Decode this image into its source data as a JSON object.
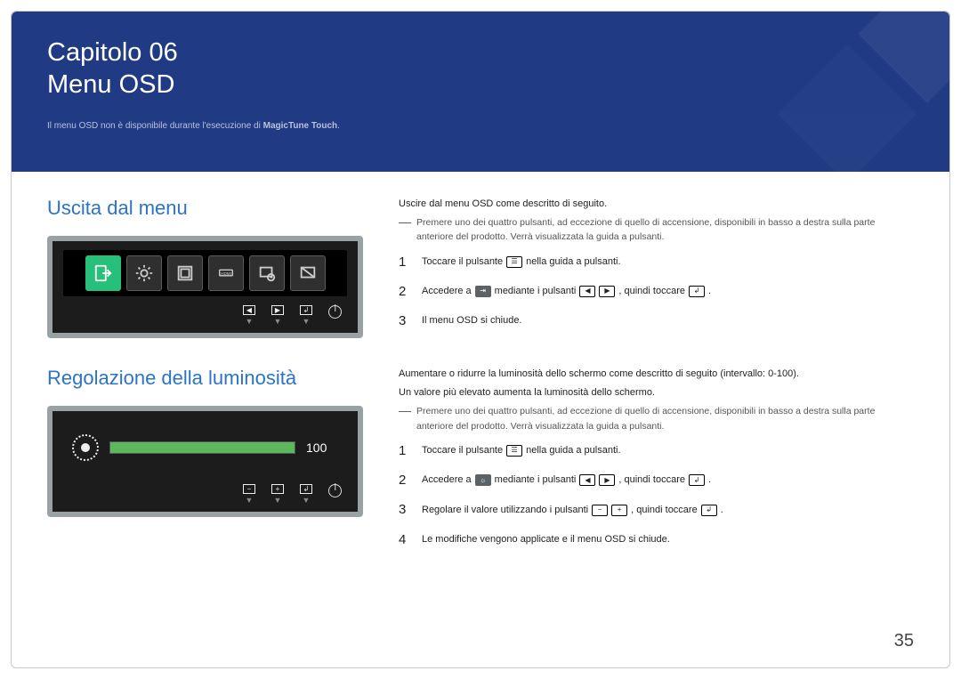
{
  "header": {
    "chapter_label": "Capitolo 06",
    "title": "Menu OSD",
    "note_prefix": "Il menu OSD non è disponibile durante l'esecuzione di ",
    "note_bold": "MagicTune Touch",
    "note_suffix": "."
  },
  "section_exit": {
    "title": "Uscita dal menu",
    "intro": "Uscire dal menu OSD come descritto di seguito.",
    "dash_note": "Premere uno dei quattro pulsanti, ad eccezione di quello di accensione, disponibili in basso a destra sulla parte anteriore del prodotto. Verrà visualizzata la guida a pulsanti.",
    "steps": {
      "s1_a": "Toccare il pulsante",
      "s1_b": "nella guida a pulsanti.",
      "s2_a": "Accedere a",
      "s2_b": "mediante i pulsanti",
      "s2_c": ", quindi toccare",
      "s2_d": ".",
      "s3": "Il menu OSD si chiude."
    }
  },
  "section_bright": {
    "title": "Regolazione della luminosità",
    "intro1": "Aumentare o ridurre la luminosità dello schermo come descritto di seguito (intervallo: 0-100).",
    "intro2": "Un valore più elevato aumenta la luminosità dello schermo.",
    "dash_note": "Premere uno dei quattro pulsanti, ad eccezione di quello di accensione, disponibili in basso a destra sulla parte anteriore del prodotto. Verrà visualizzata la guida a pulsanti.",
    "steps": {
      "s1_a": "Toccare il pulsante",
      "s1_b": "nella guida a pulsanti.",
      "s2_a": "Accedere a",
      "s2_b": "mediante i pulsanti",
      "s2_c": ", quindi toccare",
      "s2_d": ".",
      "s3_a": "Regolare il valore utilizzando i pulsanti",
      "s3_b": ", quindi toccare",
      "s3_c": ".",
      "s4": "Le modifiche vengono applicate e il menu OSD si chiude."
    },
    "slider_value": "100"
  },
  "icons": {
    "menu_glyph": "☰",
    "left_arrow": "◀",
    "right_arrow": "▶",
    "enter": "↲",
    "minus": "−",
    "plus": "+"
  },
  "page_number": "35",
  "colors": {
    "accent_blue": "#2b74c6",
    "header_bg": "#203b84",
    "osd_green": "#27c07a"
  }
}
